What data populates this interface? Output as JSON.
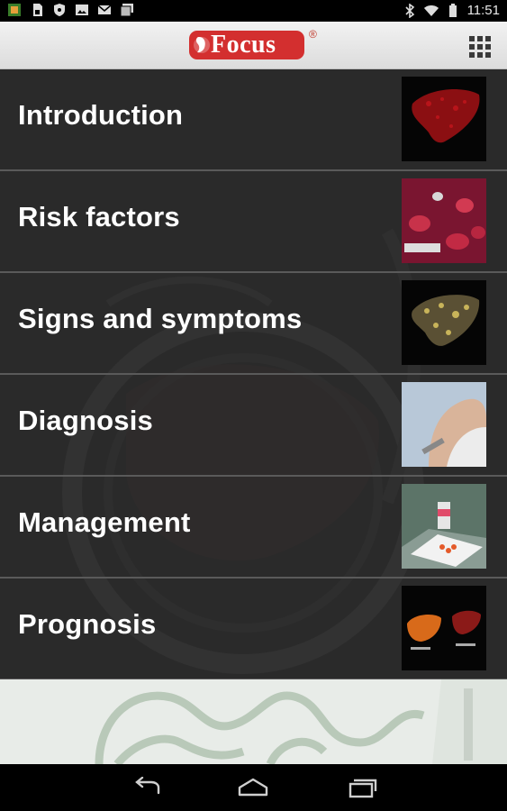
{
  "status_bar": {
    "time": "11:51",
    "left_icons": [
      "app-icon",
      "sd-card-icon",
      "shield-icon",
      "image-icon",
      "gmail-icon",
      "gallery-icon"
    ],
    "right_icons": [
      "bluetooth-icon",
      "wifi-icon",
      "battery-icon"
    ]
  },
  "header": {
    "logo_text": "Focus",
    "logo_registered": "®",
    "brand_color": "#d32f2f"
  },
  "menu": {
    "items": [
      {
        "label": "Introduction",
        "thumb": "liver-red-thumb"
      },
      {
        "label": "Risk factors",
        "thumb": "blood-cells-thumb"
      },
      {
        "label": "Signs and symptoms",
        "thumb": "cirrhotic-liver-thumb"
      },
      {
        "label": "Diagnosis",
        "thumb": "biopsy-thumb"
      },
      {
        "label": "Management",
        "thumb": "medication-thumb"
      },
      {
        "label": "Prognosis",
        "thumb": "liver-comparison-thumb"
      }
    ]
  },
  "nav_bar": {
    "buttons": [
      "back-icon",
      "home-icon",
      "recent-apps-icon"
    ]
  }
}
